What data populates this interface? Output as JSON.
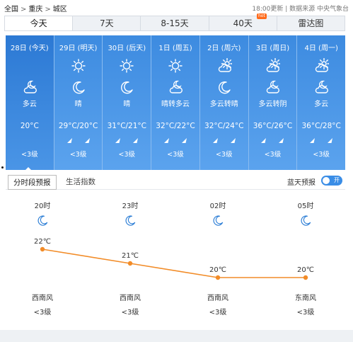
{
  "breadcrumb": {
    "items": [
      "全国",
      "重庆",
      "城区"
    ],
    "separator": ">"
  },
  "header": {
    "update_text": "18:00更新",
    "divider": "|",
    "source_text": "数据来源 中央气象台"
  },
  "tabs": [
    {
      "label": "今天",
      "active": true
    },
    {
      "label": "7天",
      "active": false
    },
    {
      "label": "8-15天",
      "active": false
    },
    {
      "label": "40天",
      "active": false,
      "badge": "hot"
    },
    {
      "label": "雷达图",
      "active": false
    }
  ],
  "days": [
    {
      "date": "28日 (今天)",
      "icons": [
        "cloud-moon-icon"
      ],
      "condition": "多云",
      "temp": "20°C",
      "wind_icons": [],
      "level": "<3级",
      "selected": true
    },
    {
      "date": "29日 (明天)",
      "icons": [
        "sun-icon",
        "moon-icon"
      ],
      "condition": "晴",
      "temp": "29°C/20°C",
      "wind_icons": [
        "wind-arrow-icon",
        "wind-arrow-icon"
      ],
      "level": "<3级"
    },
    {
      "date": "30日 (后天)",
      "icons": [
        "sun-icon",
        "moon-icon"
      ],
      "condition": "晴",
      "temp": "31°C/21°C",
      "wind_icons": [
        "wind-arrow-icon",
        "wind-arrow-icon"
      ],
      "level": "<3级"
    },
    {
      "date": "1日 (周五)",
      "icons": [
        "sun-icon",
        "cloud-moon-icon"
      ],
      "condition": "晴转多云",
      "temp": "32°C/22°C",
      "wind_icons": [
        "wind-arrow-icon",
        "wind-arrow-icon"
      ],
      "level": "<3级"
    },
    {
      "date": "2日 (周六)",
      "icons": [
        "cloud-sun-icon",
        "moon-icon"
      ],
      "condition": "多云转晴",
      "temp": "32°C/24°C",
      "wind_icons": [
        "wind-arrow-icon",
        "wind-arrow-icon"
      ],
      "level": "<3级"
    },
    {
      "date": "3日 (周日)",
      "icons": [
        "cloud-sun-icon",
        "cloud-moon-icon"
      ],
      "condition": "多云转阴",
      "temp": "36°C/26°C",
      "wind_icons": [
        "wind-arrow-icon",
        "wind-arrow-icon"
      ],
      "level": "<3级"
    },
    {
      "date": "4日 (周一)",
      "icons": [
        "cloud-sun-icon",
        "cloud-moon-icon"
      ],
      "condition": "多云",
      "temp": "36°C/28°C",
      "wind_icons": [
        "wind-arrow-icon",
        "wind-arrow-icon"
      ],
      "level": "<3级"
    }
  ],
  "subtabs": [
    {
      "label": "分时段预报",
      "active": true
    },
    {
      "label": "生活指数",
      "active": false
    }
  ],
  "radar_toggle": {
    "label": "蓝天预报",
    "state": "开"
  },
  "colors": {
    "day_bg": "#4595e8",
    "accent": "#3a8de6",
    "curve": "#f28c28",
    "hot": "#ff6a1a"
  },
  "chart_data": {
    "type": "line",
    "x": [
      "20时",
      "23时",
      "02时",
      "05时"
    ],
    "series": [
      {
        "values": [
          22,
          21,
          20,
          20
        ]
      }
    ],
    "point_labels": [
      "22℃",
      "21℃",
      "20℃",
      "20℃"
    ],
    "icons": [
      "moon-icon",
      "moon-icon",
      "moon-icon",
      "moon-icon"
    ],
    "wind_directions": [
      "西南风",
      "西南风",
      "西南风",
      "东南风"
    ],
    "wind_levels": [
      "<3级",
      "<3级",
      "<3级",
      "<3级"
    ],
    "ylim": [
      19,
      23
    ]
  }
}
